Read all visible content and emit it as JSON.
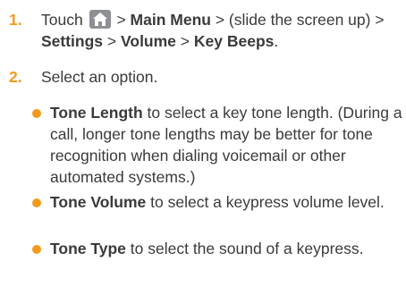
{
  "steps": [
    {
      "number": "1.",
      "parts": {
        "touch": "Touch",
        "home_icon": "home-icon",
        "sep1": " > ",
        "main_menu": "Main Menu",
        "sep2": " > ",
        "slide": "(slide the screen up)",
        "sep3": " > ",
        "settings": "Settings",
        "sep4": " > ",
        "volume": "Volume",
        "sep5": " > ",
        "key_beeps": "Key Beeps",
        "period": "."
      }
    },
    {
      "number": "2.",
      "text": "Select an option."
    }
  ],
  "options": [
    {
      "title": "Tone Length",
      "desc": " to select a key tone length. (During a call, longer tone lengths may be better for tone recognition when dialing voicemail or other automated systems.)"
    },
    {
      "title": "Tone Volume",
      "desc": " to select a keypress volume level."
    },
    {
      "title": "Tone Type",
      "desc": " to select the sound of a keypress."
    }
  ],
  "colors": {
    "accent": "#f39a1e",
    "text": "#3a3a3a",
    "icon_bg": "#8f9094"
  }
}
